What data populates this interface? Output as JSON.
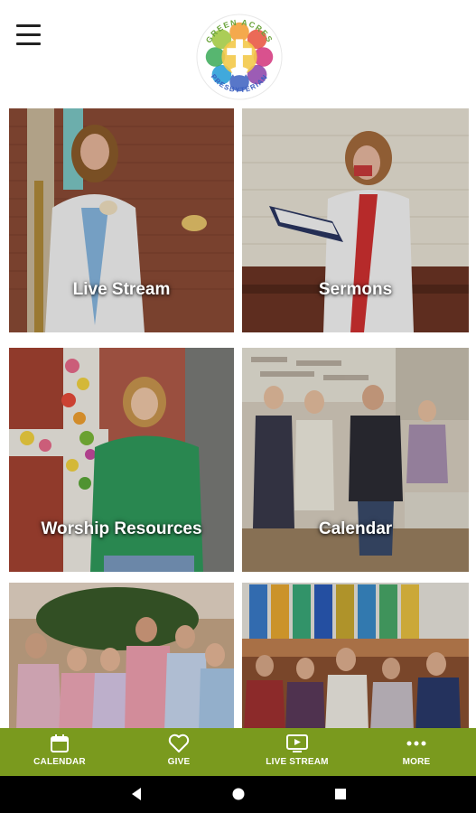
{
  "header": {
    "menu_icon": "hamburger-menu-icon",
    "logo": {
      "arc_top": "GREEN ACRES",
      "arc_bottom": "PRESBYTERIAN"
    }
  },
  "tiles": [
    {
      "label": "Live Stream"
    },
    {
      "label": "Sermons"
    },
    {
      "label": "Worship Resources"
    },
    {
      "label": "Calendar"
    },
    {
      "label": ""
    },
    {
      "label": ""
    }
  ],
  "tabbar": {
    "background": "#7a9a1e",
    "items": [
      {
        "label": "CALENDAR",
        "icon": "calendar-icon"
      },
      {
        "label": "GIVE",
        "icon": "heart-icon"
      },
      {
        "label": "LIVE STREAM",
        "icon": "tv-play-icon"
      },
      {
        "label": "MORE",
        "icon": "more-dots-icon"
      }
    ]
  },
  "system_nav": {
    "buttons": [
      "back-icon",
      "home-icon",
      "recents-icon"
    ]
  }
}
